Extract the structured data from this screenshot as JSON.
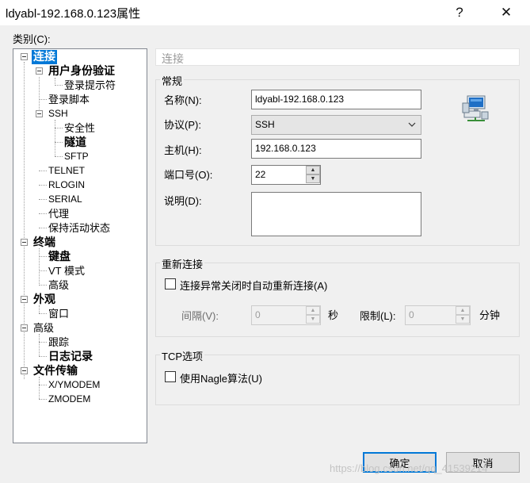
{
  "window": {
    "title": "ldyabl-192.168.0.123属性",
    "help_glyph": "?",
    "close_glyph": "✕"
  },
  "category_label": "类别(C):",
  "tree": {
    "items": [
      {
        "label": "连接"
      },
      {
        "label": "用户身份验证"
      },
      {
        "label": "登录提示符"
      },
      {
        "label": "登录脚本"
      },
      {
        "label": "SSH"
      },
      {
        "label": "安全性"
      },
      {
        "label": "隧道"
      },
      {
        "label": "SFTP"
      },
      {
        "label": "TELNET"
      },
      {
        "label": "RLOGIN"
      },
      {
        "label": "SERIAL"
      },
      {
        "label": "代理"
      },
      {
        "label": "保持活动状态"
      },
      {
        "label": "终端"
      },
      {
        "label": "键盘"
      },
      {
        "label": "VT 模式"
      },
      {
        "label": "高级"
      },
      {
        "label": "外观"
      },
      {
        "label": "窗口"
      },
      {
        "label": "高级"
      },
      {
        "label": "跟踪"
      },
      {
        "label": "日志记录"
      },
      {
        "label": "文件传输"
      },
      {
        "label": "X/YMODEM"
      },
      {
        "label": "ZMODEM"
      }
    ],
    "selected": "连接"
  },
  "panel": {
    "section_title": "连接",
    "general": {
      "group_label": "常规",
      "name_label": "名称(N):",
      "name_value": "ldyabl-192.168.0.123",
      "protocol_label": "协议(P):",
      "protocol_value": "SSH",
      "host_label": "主机(H):",
      "host_value": "192.168.0.123",
      "port_label": "端口号(O):",
      "port_value": "22",
      "desc_label": "说明(D):",
      "desc_value": ""
    },
    "reconnect": {
      "group_label": "重新连接",
      "auto_reconnect_label": "连接异常关闭时自动重新连接(A)",
      "auto_reconnect_checked": false,
      "interval_label": "间隔(V):",
      "interval_value": "0",
      "interval_unit": "秒",
      "limit_label": "限制(L):",
      "limit_value": "0",
      "limit_unit": "分钟"
    },
    "tcp": {
      "group_label": "TCP选项",
      "nagle_label": "使用Nagle算法(U)",
      "nagle_checked": false
    }
  },
  "buttons": {
    "ok": "确定",
    "cancel": "取消"
  },
  "watermark": "https://blog.csdn.net/qq_41539214",
  "colors": {
    "selection": "#0078d7",
    "window_bg": "#f0f0f0"
  }
}
